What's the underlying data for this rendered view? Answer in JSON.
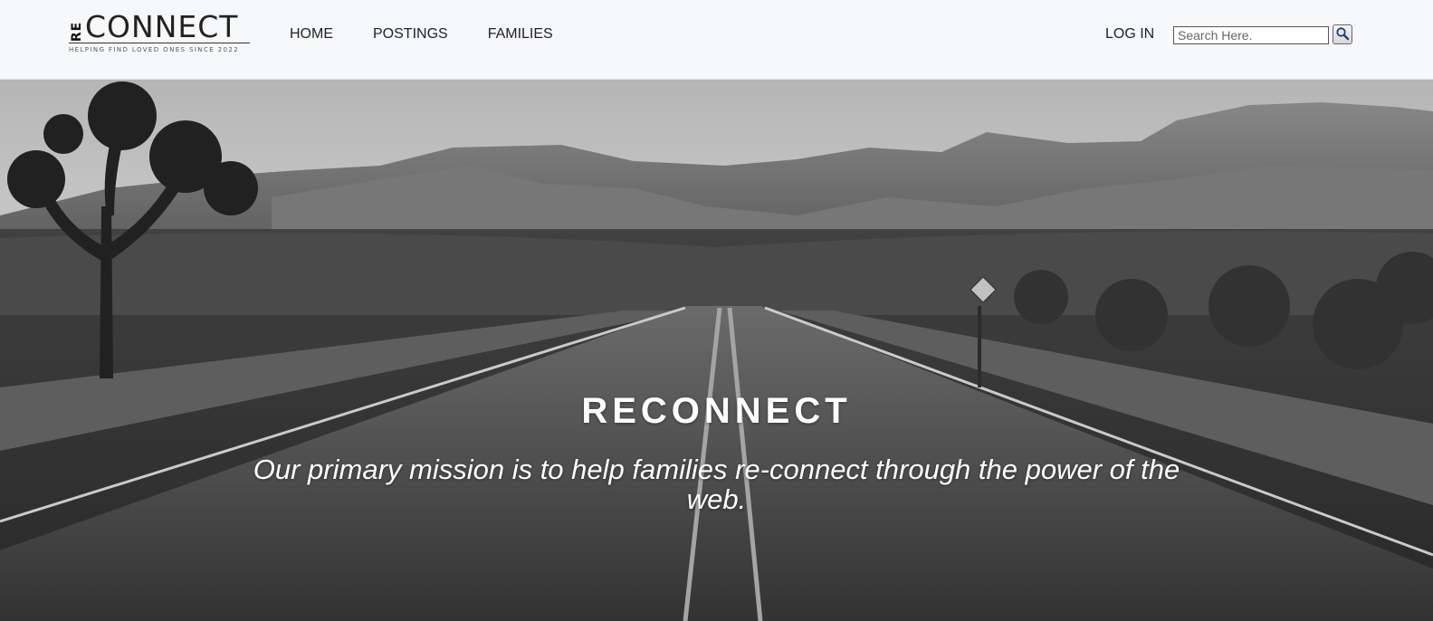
{
  "logo": {
    "re": "RE",
    "connect": "CONNECT",
    "tagline": "HELPING FIND LOVED ONES SINCE 2022"
  },
  "nav": {
    "items": [
      {
        "label": "HOME"
      },
      {
        "label": "POSTINGS"
      },
      {
        "label": "FAMILIES"
      }
    ],
    "login": "LOG IN"
  },
  "search": {
    "placeholder": "Search Here.",
    "value": "",
    "icon": "magnifier-icon"
  },
  "hero": {
    "title": "RECONNECT",
    "subtitle": "Our primary mission is to help families re-connect through the power of the web."
  }
}
